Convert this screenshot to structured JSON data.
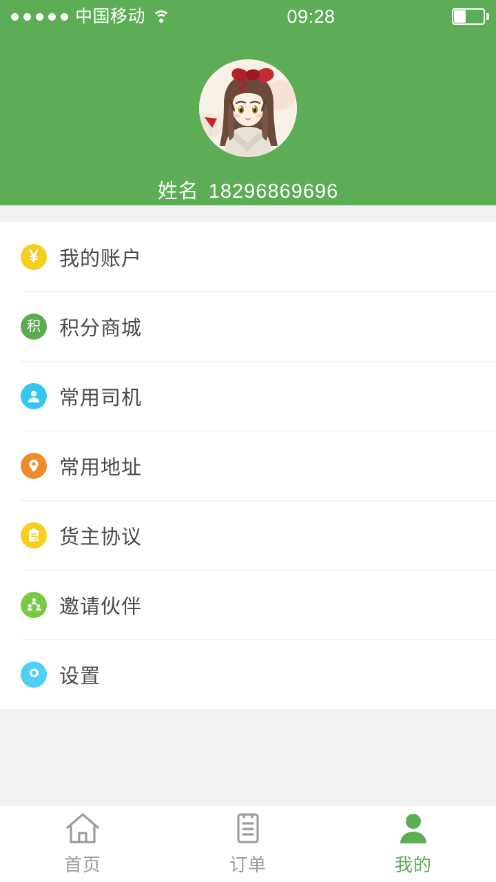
{
  "statusbar": {
    "signal_dots": 5,
    "carrier": "中国移动",
    "wifi_icon": "wifi-icon",
    "time": "09:28",
    "battery_icon": "battery-icon",
    "battery_level_pct": 35
  },
  "profile": {
    "avatar_alt": "user-avatar",
    "name_label": "姓名",
    "phone": "18296869696"
  },
  "menu": {
    "items": [
      {
        "label": "我的账户",
        "icon": "yen-coin-icon",
        "glyph": "¥",
        "color": "#f5ce1e"
      },
      {
        "label": "积分商城",
        "icon": "points-icon",
        "glyph": "积",
        "color": "#5cab4f"
      },
      {
        "label": "常用司机",
        "icon": "driver-icon",
        "glyph": "",
        "color": "#34c6f0"
      },
      {
        "label": "常用地址",
        "icon": "location-pin-icon",
        "glyph": "",
        "color": "#f08b2a"
      },
      {
        "label": "货主协议",
        "icon": "agreement-icon",
        "glyph": "",
        "color": "#f5ce1e"
      },
      {
        "label": "邀请伙伴",
        "icon": "invite-group-icon",
        "glyph": "",
        "color": "#7ac943"
      },
      {
        "label": "设置",
        "icon": "gear-icon",
        "glyph": "",
        "color": "#4dd0f7"
      }
    ]
  },
  "tabbar": {
    "items": [
      {
        "label": "首页",
        "icon": "home-icon",
        "active": false
      },
      {
        "label": "订单",
        "icon": "orders-icon",
        "active": false
      },
      {
        "label": "我的",
        "icon": "profile-icon",
        "active": true
      }
    ]
  },
  "theme": {
    "header_green": "#5cad55",
    "active_green": "#5cad55",
    "page_bg": "#f1f2f2",
    "text_dark": "#4a4a4a",
    "text_muted": "#9b9b9b"
  }
}
